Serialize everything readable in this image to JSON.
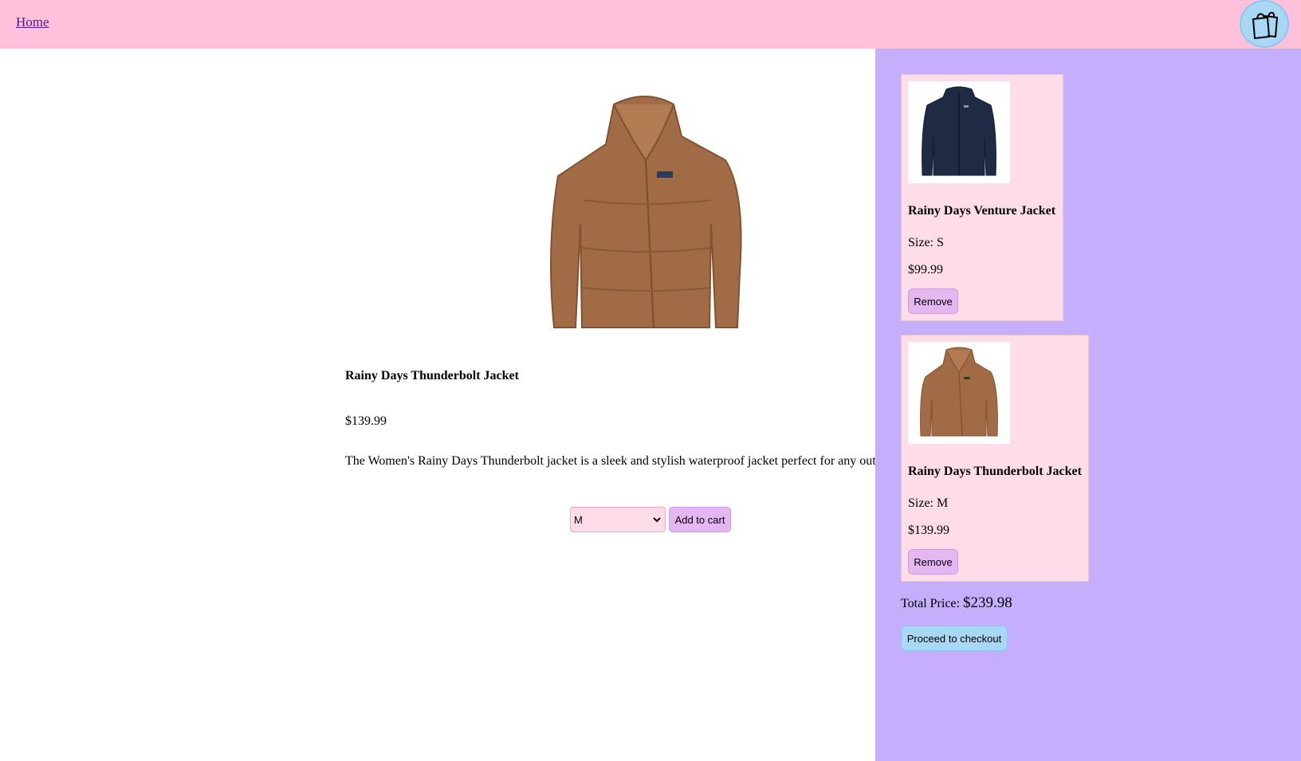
{
  "nav": {
    "home_label": "Home",
    "cart_icon": "shopping-bags-icon"
  },
  "product": {
    "name": "Rainy Days Thunderbolt Jacket",
    "price": "$139.99",
    "description": "The Women's Rainy Days Thunderbolt jacket is a sleek and stylish waterproof jacket perfect for any out",
    "image_icon": "brown-fleece-jacket-image",
    "selected_size": "M",
    "add_to_cart_label": "Add to cart"
  },
  "cart": {
    "items": [
      {
        "name": "Rainy Days Venture Jacket",
        "size": "Size: S",
        "price": "$99.99",
        "remove_label": "Remove",
        "image_icon": "navy-fleece-jacket-image"
      },
      {
        "name": "Rainy Days Thunderbolt Jacket",
        "size": "Size: M",
        "price": "$139.99",
        "remove_label": "Remove",
        "image_icon": "brown-fleece-jacket-image"
      }
    ],
    "total_label": "Total Price:",
    "total_amount": "$239.98",
    "checkout_label": "Proceed to checkout"
  },
  "colors": {
    "topbar": "#ffc0db",
    "cart_panel": "#c5aefc",
    "cart_item_bg": "#ffdde8",
    "button_purple": "#e4b7f3",
    "button_blue": "#a9d8f5",
    "jacket_brown": "#a06b45",
    "jacket_navy": "#1f2a44"
  }
}
